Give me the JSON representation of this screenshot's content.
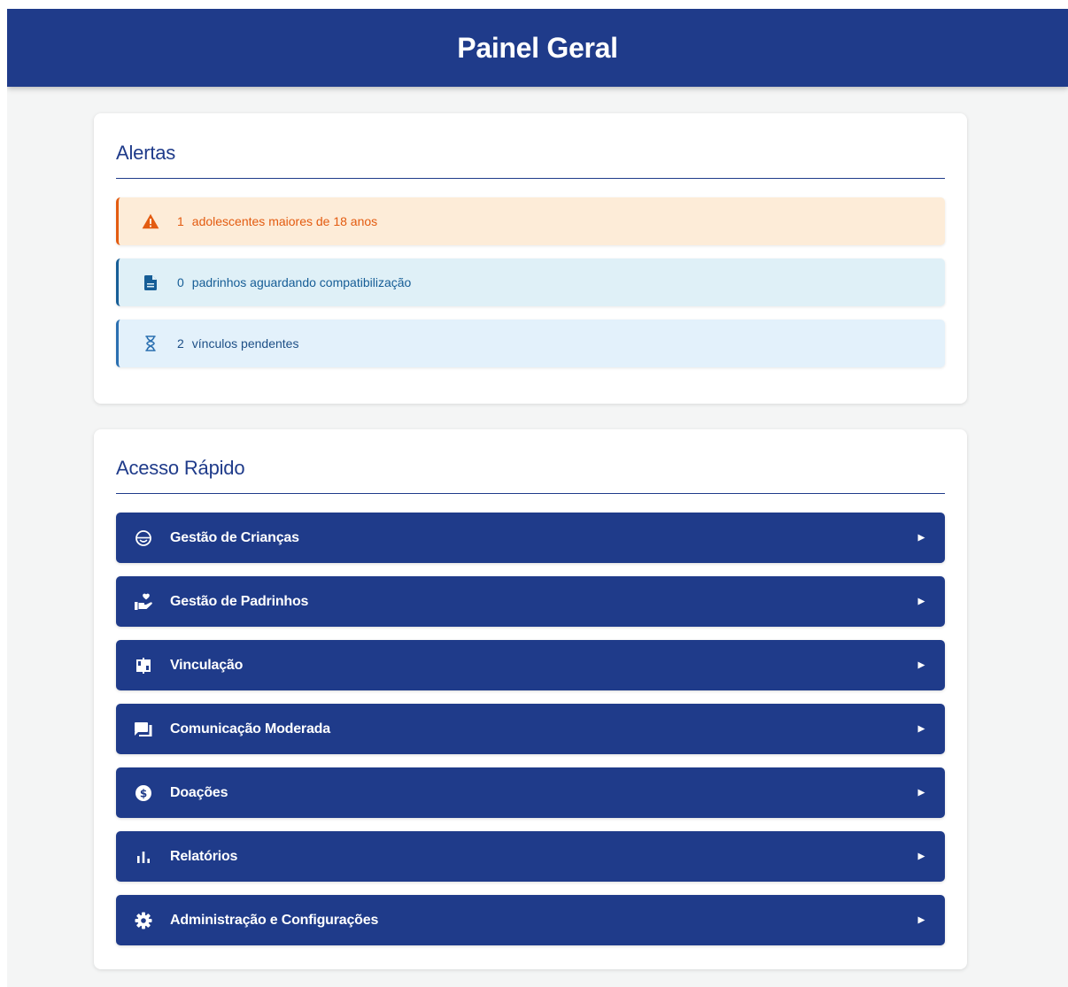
{
  "header": {
    "title": "Painel Geral"
  },
  "alerts": {
    "title": "Alertas",
    "items": [
      {
        "count": "1",
        "text": "adolescentes maiores de 18 anos",
        "icon": "warning-icon",
        "color": "#e35b10"
      },
      {
        "count": "0",
        "text": "padrinhos aguardando compatibilização",
        "icon": "document-icon",
        "color": "#165d96"
      },
      {
        "count": "2",
        "text": "vínculos pendentes",
        "icon": "hourglass-icon",
        "color": "#1d4f86"
      }
    ]
  },
  "quick_access": {
    "title": "Acesso Rápido",
    "items": [
      {
        "label": "Gestão de Crianças",
        "icon": "child-face-icon"
      },
      {
        "label": "Gestão de Padrinhos",
        "icon": "volunteer-hand-heart-icon"
      },
      {
        "label": "Vinculação",
        "icon": "link-book-icon"
      },
      {
        "label": "Comunicação Moderada",
        "icon": "chat-bubbles-icon"
      },
      {
        "label": "Doações",
        "icon": "dollar-coin-icon"
      },
      {
        "label": "Relatórios",
        "icon": "bar-chart-icon"
      },
      {
        "label": "Administração e Configurações",
        "icon": "gear-icon"
      }
    ]
  },
  "colors": {
    "primary": "#1f3b8a",
    "warning": "#e35b10",
    "info": "#165d96",
    "background": "#f4f5f5"
  }
}
